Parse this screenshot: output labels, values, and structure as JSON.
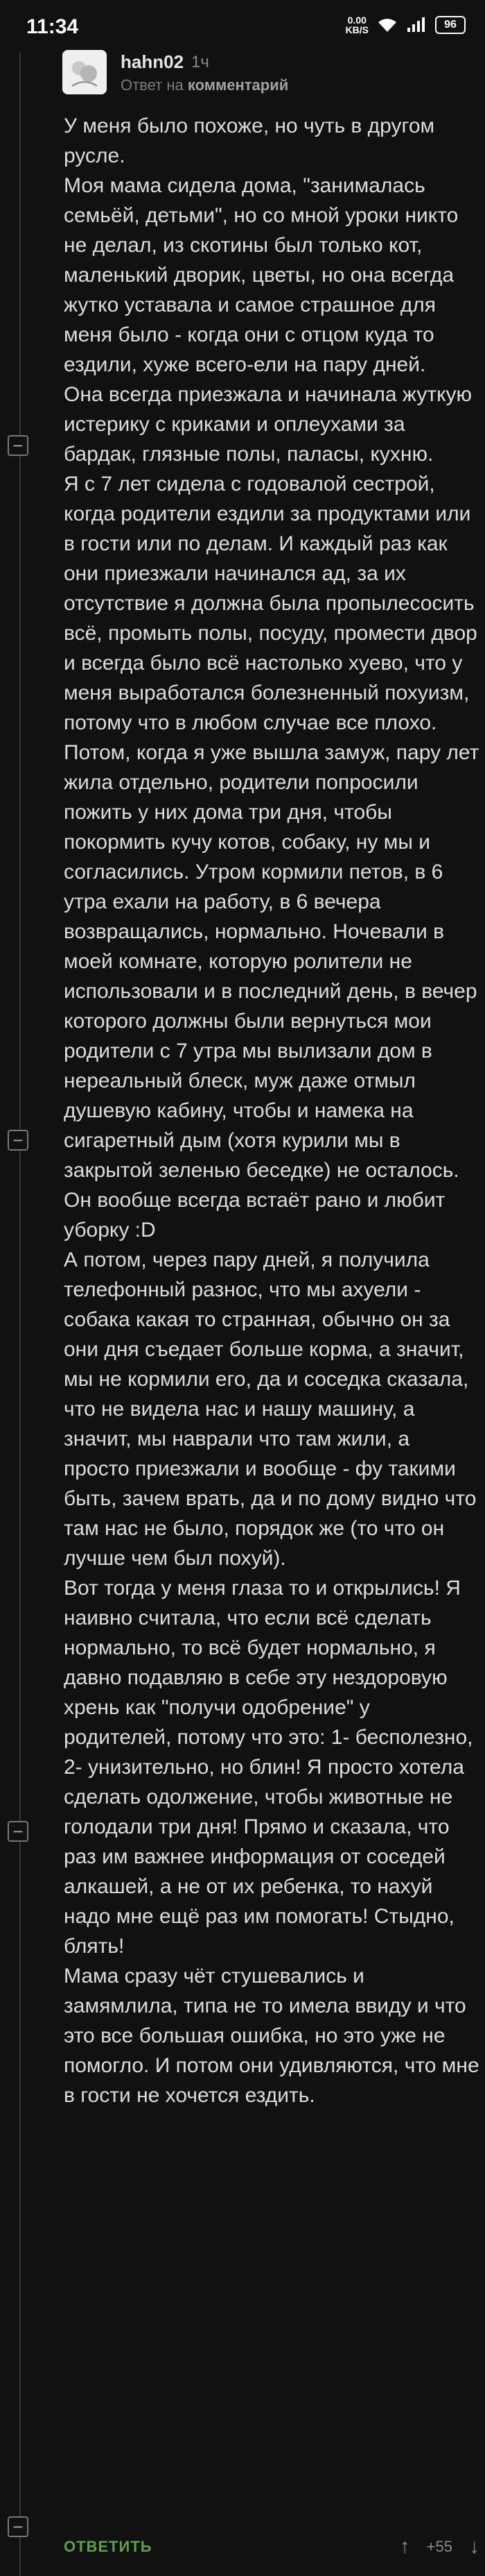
{
  "status_bar": {
    "time": "11:34",
    "net_speed_value": "0.00",
    "net_speed_unit": "KB/S",
    "battery": "96"
  },
  "comment": {
    "username": "hahn02",
    "time_ago": "1ч",
    "reply_prefix": "Ответ на",
    "reply_target": "комментарий",
    "body": "У меня было похоже, но чуть в другом русле.\nМоя мама сидела дома, \"занималась семьёй, детьми\", но со мной уроки никто не делал, из скотины был только кот, маленький дворик, цветы, но она всегда жутко уставала и самое страшное для меня было - когда они с отцом куда то ездили, хуже всего-ели на пару дней.\nОна всегда приезжала и начинала жуткую истерику с криками и оплеухами за бардак, глязные полы, паласы, кухню.\nЯ с 7 лет сидела с годовалой сестрой, когда родители ездили за продуктами или в гости или по делам. И каждый раз как они приезжали начинался ад, за их отсутствие я должна была пропылесосить всё, промыть полы, посуду, промести двор и всегда было всё настолько хуево, что у меня выработался болезненный похуизм, потому что в любом случае все плохо.\nПотом, когда я уже вышла замуж, пару лет жила отдельно, родители попросили пожить у них дома три дня, чтобы покормить кучу котов, собаку, ну мы и согласились. Утром кормили петов, в 6 утра ехали на работу, в 6 вечера возвращались, нормально. Ночевали в моей комнате, которую ролители не использовали и в последний день, в вечер которого должны были вернуться мои родители с 7 утра мы вылизали дом в нереальный блеск, муж даже отмыл душевую кабину, чтобы и намека на сигаретный дым (хотя курили мы в закрытой зеленью беседке) не осталось. Он вообще всегда встаёт рано и любит уборку :D\nА потом, через пару дней, я получила телефонный разнос, что мы ахуели - собака какая то странная, обычно он за они дня съедает больше корма, а значит, мы не кормили его, да и соседка сказала, что не видела нас и нашу машину, а значит, мы наврали что там жили, а просто приезжали и вообще - фу такими быть, зачем врать, да и по дому видно что там нас не было, порядок же (то что он лучше чем был похуй).\nВот тогда у меня глаза то и открылись! Я наивно считала, что если всё сделать нормально, то всё будет нормально, я давно подавляю в себе эту нездоровую хрень как \"получи одобрение\" у родителей, потому что это: 1- бесполезно, 2- унизительно, но блин! Я просто хотела сделать одолжение, чтобы животные не голодали три дня! Прямо и сказала, что раз им важнее информация от соседей алкашей, а не от их ребенка, то нахуй надо мне ещё раз им помогать! Стыдно, блять!\nМама сразу чёт стушевались и замямлилa, типа не то имела ввиду и что это все большая ошибка, но это уже не помогло. И потом они удивляются, что мне в гости не хочется ездить."
  },
  "actions": {
    "reply_label": "ОТВЕТИТЬ",
    "score": "+55",
    "upvote_icon": "arrow-up-icon",
    "downvote_icon": "arrow-down-icon"
  },
  "collapse_symbol": "−"
}
